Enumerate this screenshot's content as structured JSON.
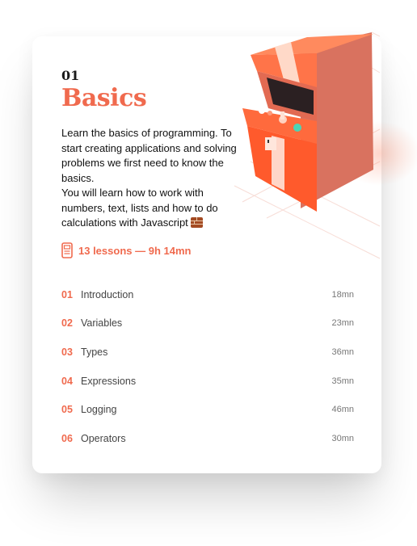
{
  "chapter": {
    "number": "01",
    "title": "Basics",
    "description_1": "Learn the basics of programming. To start creating applications and solving problems we first need to know the basics.",
    "description_2": "You will learn how to work with numbers, text, lists and how to do calculations with Javascript",
    "emoji_icon": "brick-icon",
    "lessons_summary": "13 lessons — 9h 14mn",
    "summary_icon": "book-icon"
  },
  "lessons": [
    {
      "number": "01",
      "name": "Introduction",
      "duration": "18mn"
    },
    {
      "number": "02",
      "name": "Variables",
      "duration": "23mn"
    },
    {
      "number": "03",
      "name": "Types",
      "duration": "36mn"
    },
    {
      "number": "04",
      "name": "Expressions",
      "duration": "35mn"
    },
    {
      "number": "05",
      "name": "Logging",
      "duration": "46mn"
    },
    {
      "number": "06",
      "name": "Operators",
      "duration": "30mn"
    }
  ],
  "colors": {
    "accent": "#f06a4e",
    "cabinet_orange": "#ff6a3d",
    "cabinet_salmon": "#e07a66"
  }
}
